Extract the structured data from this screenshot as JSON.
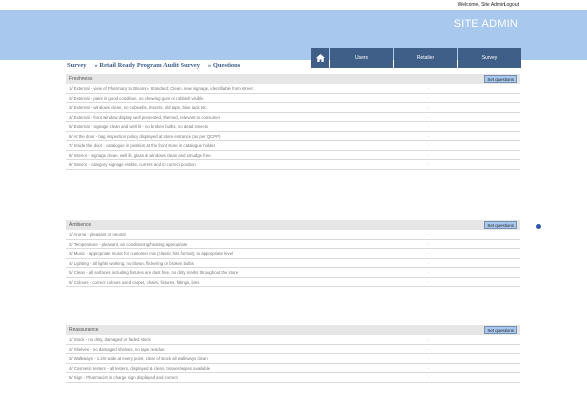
{
  "topbar": {
    "welcome": "Welcome, Site Admin",
    "logout": "Logout"
  },
  "header": {
    "site_title": "SITE ADMIN"
  },
  "nav": {
    "home_icon": "home-icon",
    "items": [
      "Users",
      "Retailer",
      "Survey"
    ]
  },
  "breadcrumb": [
    "Survey",
    "» Retail Ready Program Audit Survey",
    "» Questions"
  ],
  "colors": {
    "header_bg": "#a8c8ee",
    "nav_bg": "#3f5f88",
    "accent": "#3d5c88"
  },
  "sections": [
    {
      "title": "Freshness",
      "button": "Set questions",
      "rows": [
        {
          "q": "1/ External - view of Pharmacy to Bloomo- Standard: Clean, new signage, identifiable from street",
          "a": "-"
        },
        {
          "q": "2/ External - paint in good condition, no chewing gum or rubbish visible",
          "a": "-"
        },
        {
          "q": "3/ External - windows clean, no cobwebs, insects, old tape, blue tack etc.",
          "a": "-"
        },
        {
          "q": "4/ External - front window display well presented, themed, relevant to consumer",
          "a": "-"
        },
        {
          "q": "5/ External - signage clean and well lit - no broken bulbs, no dead insects",
          "a": "-"
        },
        {
          "q": "6/ At the door - bag inspection policy displayed at store entrance (as per QCPP)",
          "a": "-"
        },
        {
          "q": "7/ Inside the door - catalogue in position at the front store in catalogue holder",
          "a": "-"
        },
        {
          "q": "8/ Interior - signage clean, well lit, glass & windows clean and smudge free.",
          "a": "-"
        },
        {
          "q": "9/ Interior - category signage visible, current and in correct position",
          "a": "-"
        }
      ]
    },
    {
      "title": "Ambience",
      "button": "Set questions",
      "rows": [
        {
          "q": "1/ Aroma - pleasant or neutral",
          "a": "-"
        },
        {
          "q": "2/ Temperature - pleasant, air conditioning/heating appropriate",
          "a": "-"
        },
        {
          "q": "3/ Music - appropriate music for customer mix (classic hits format), to appropriate level",
          "a": "-"
        },
        {
          "q": "4/ Lighting - all lights working, no blown, flickering or broken bulbs",
          "a": "-"
        },
        {
          "q": "5/ Clean - all surfaces including fixtures are dust free, no dirty marks throughout the store",
          "a": "-"
        },
        {
          "q": "6/ Colours - correct colours used carpet, chairs, fixtures, fittings, bins",
          "a": "-"
        }
      ]
    },
    {
      "title": "Reassurance",
      "button": "Set questions",
      "rows": [
        {
          "q": "1/ Stock - no dirty, damaged or faded stock",
          "a": "-"
        },
        {
          "q": "2/ Shelves - no damaged shelves, no tape residue.",
          "a": "-"
        },
        {
          "q": "3/ Walkways - 1.2m wide at every point, clear of stock all walkways clean",
          "a": "-"
        },
        {
          "q": "4/ Cosmetic testers - all testers, displayed & clean, tissues/wipes available",
          "a": "-"
        },
        {
          "q": "5/ Sign - Pharmacist in charge sign displayed and correct",
          "a": "-"
        }
      ]
    }
  ]
}
